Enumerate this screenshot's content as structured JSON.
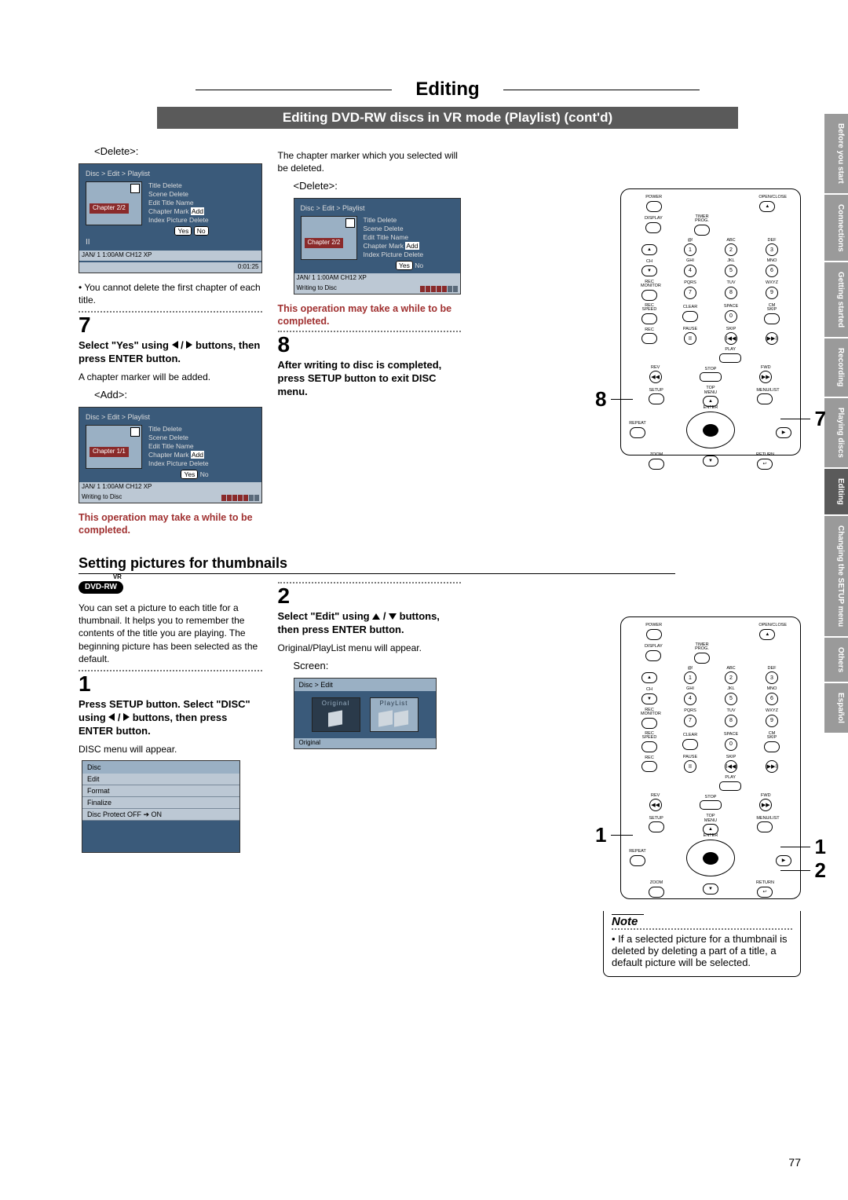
{
  "sidebar": {
    "tabs": [
      "Before you start",
      "Connections",
      "Getting started",
      "Recording",
      "Playing discs",
      "Editing",
      "Changing the SETUP menu",
      "Others",
      "Español"
    ],
    "active_index": 5
  },
  "header": {
    "title": "Editing",
    "subtitle": "Editing DVD-RW discs in VR mode (Playlist) (cont'd)"
  },
  "col1": {
    "delete_label": "<Delete>:",
    "osd1": {
      "path": "Disc > Edit > Playlist",
      "menu": [
        "Title Delete",
        "Scene Delete",
        "Edit Title Name",
        "Chapter Mark",
        "Index Picture"
      ],
      "menu_suffix": [
        "",
        "",
        "",
        "Add",
        "Delete"
      ],
      "chapter": "Chapter 2/2",
      "yes": "Yes",
      "no": "No",
      "status": "JAN/ 1   1:00AM  CH12      XP",
      "time": "0:01:25"
    },
    "bullet1": "• You cannot delete the first chapter of each title.",
    "step7_num": "7",
    "step7_instr": "Select \"Yes\" using ◀ / ▶ buttons, then press ENTER button.",
    "step7_body": "A chapter marker will be added.",
    "add_label": "<Add>:",
    "osd2": {
      "path": "Disc > Edit > Playlist",
      "menu": [
        "Title Delete",
        "Scene Delete",
        "Edit Title Name",
        "Chapter Mark",
        "Index Picture"
      ],
      "menu_suffix": [
        "",
        "",
        "",
        "Add",
        "Delete"
      ],
      "chapter": "Chapter 1/1",
      "yes": "Yes",
      "no": "No",
      "status": "JAN/ 1   1:00AM  CH12      XP",
      "writing": "Writing to Disc"
    },
    "warn": "This operation may take a while to be completed."
  },
  "col2": {
    "intro": "The chapter marker which you selected will be deleted.",
    "delete_label": "<Delete>:",
    "osd3": {
      "path": "Disc > Edit > Playlist",
      "menu": [
        "Title Delete",
        "Scene Delete",
        "Edit Title Name",
        "Chapter Mark",
        "Index Picture"
      ],
      "menu_suffix": [
        "",
        "",
        "",
        "Add",
        "Delete"
      ],
      "chapter": "Chapter 2/2",
      "yes": "Yes",
      "no": "No",
      "status": "JAN/ 1   1:00AM  CH12      XP",
      "writing": "Writing to Disc"
    },
    "warn": "This operation may take a while to be completed.",
    "step8_num": "8",
    "step8_instr": "After writing to disc is completed, press SETUP button to exit DISC menu."
  },
  "section2": {
    "title": "Setting pictures for thumbnails",
    "badge": "DVD-RW",
    "intro": "You can set a picture to each title for a thumbnail. It helps you to remember the contents of the title you are playing. The beginning picture has been selected as the default.",
    "step1_num": "1",
    "step1_instr": "Press SETUP button. Select \"DISC\" using ◀ / ▶ buttons, then press ENTER button.",
    "step1_body": "DISC menu will appear.",
    "disc_menu": {
      "header": "Disc",
      "items": [
        "Edit",
        "Format",
        "Finalize",
        "Disc Protect OFF ➔ ON"
      ]
    },
    "step2_num": "2",
    "step2_instr": "Select \"Edit\" using ▲ / ▼ buttons, then press ENTER button.",
    "step2_body": "Original/PlayList menu will appear.",
    "screen_label": "Screen:",
    "osd4": {
      "path": "Disc > Edit",
      "opt1": "Original",
      "opt2": "PlayList",
      "footer": "Original"
    }
  },
  "remote_labels": {
    "power": "POWER",
    "openclose": "OPEN/CLOSE",
    "display": "DISPLAY",
    "timer": "TIMER PROG.",
    "abc": "ABC",
    "def": "DEF",
    "ch": "CH",
    "ghi": "GHI",
    "jkl": "JKL",
    "mno": "MNO",
    "rec_monitor": "REC MONITOR",
    "pqrs": "PQRS",
    "tuv": "TUV",
    "wxyz": "WXYZ",
    "rec_speed": "REC SPEED",
    "clear": "CLEAR",
    "space": "SPACE",
    "cm_skip": "CM SKIP",
    "rec": "REC",
    "pause": "PAUSE",
    "skip": "SKIP",
    "play": "PLAY",
    "rev": "REV",
    "fwd": "FWD",
    "stop": "STOP",
    "setup": "SETUP",
    "top_menu": "TOP MENU",
    "menulist": "MENU/LIST",
    "repeat": "REPEAT",
    "enter": "ENTER",
    "zoom": "ZOOM",
    "return": "RETURN"
  },
  "remote_digits": [
    "1",
    "2",
    "3",
    "4",
    "5",
    "6",
    "7",
    "8",
    "9",
    "0"
  ],
  "pointers_top": {
    "left": "8",
    "right": "7"
  },
  "pointers_bot": {
    "left": "1",
    "right1": "1",
    "right2": "2"
  },
  "note": {
    "title": "Note",
    "body": "• If a selected picture for a thumbnail is deleted by deleting a part of a title, a default picture will be selected."
  },
  "page_number": "77"
}
